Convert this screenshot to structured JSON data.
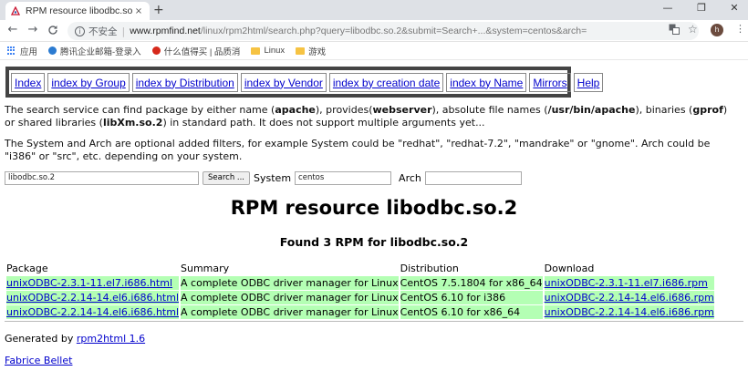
{
  "browser": {
    "tab_title": "RPM resource libodbc.so.2",
    "tab_close": "×",
    "new_tab": "+",
    "window_controls": [
      "—",
      "❐",
      "✕"
    ],
    "nav": {
      "back": "←",
      "forward": "→",
      "reload": "C"
    },
    "security_label": "不安全",
    "url_host": "www.rpmfind.net",
    "url_path": "/linux/rpm2html/search.php?query=libodbc.so.2&submit=Search+...&system=centos&arch=",
    "profile_initial": "h",
    "bookmarks": [
      {
        "label": "应用",
        "icon": "apps-icon"
      },
      {
        "label": "腾讯企业邮箱-登录入",
        "icon": "mail-favicon",
        "color": "#2b7bd1"
      },
      {
        "label": "什么值得买 | 品质消",
        "icon": "smzdm-favicon",
        "color": "#d6291b"
      },
      {
        "label": "Linux",
        "icon": "folder-icon"
      },
      {
        "label": "游戏",
        "icon": "folder-icon"
      }
    ]
  },
  "menu": [
    "Index",
    "index by Group",
    "index by Distribution",
    "index by Vendor",
    "index by creation date",
    "index by Name",
    "Mirrors",
    "Help"
  ],
  "intro": {
    "p1_a": "The search service can find package by either name (",
    "p1_b": "apache",
    "p1_c": "), provides(",
    "p1_d": "webserver",
    "p1_e": "), absolute file names (",
    "p1_f": "/usr/bin/apache",
    "p1_g": "), binaries (",
    "p1_h": "gprof",
    "p1_i": ") or shared libraries (",
    "p1_j": "libXm.so.2",
    "p1_k": ") in standard path. It does not support multiple arguments yet...",
    "p2": "The System and Arch are optional added filters, for example System could be \"redhat\", \"redhat-7.2\", \"mandrake\" or \"gnome\". Arch could be \"i386\" or \"src\", etc. depending on your system."
  },
  "search": {
    "query_value": "libodbc.so.2",
    "button_label": "Search ...",
    "system_label": "System",
    "system_value": "centos",
    "arch_label": "Arch",
    "arch_value": ""
  },
  "heading": "RPM resource libodbc.so.2",
  "subheading": "Found 3 RPM for libodbc.so.2",
  "table": {
    "headers": [
      "Package",
      "Summary",
      "Distribution",
      "Download"
    ],
    "rows": [
      {
        "package": "unixODBC-2.3.1-11.el7.i686.html",
        "summary": "A complete ODBC driver manager for Linux",
        "distribution": "CentOS 7.5.1804 for x86_64",
        "download": "unixODBC-2.3.1-11.el7.i686.rpm"
      },
      {
        "package": "unixODBC-2.2.14-14.el6.i686.html",
        "summary": "A complete ODBC driver manager for Linux",
        "distribution": "CentOS 6.10 for i386",
        "download": "unixODBC-2.2.14-14.el6.i686.rpm"
      },
      {
        "package": "unixODBC-2.2.14-14.el6.i686.html",
        "summary": "A complete ODBC driver manager for Linux",
        "distribution": "CentOS 6.10 for x86_64",
        "download": "unixODBC-2.2.14-14.el6.i686.rpm"
      }
    ]
  },
  "footer": {
    "generated_by": "Generated by ",
    "generator_link": "rpm2html 1.6",
    "author_link": "Fabrice Bellet"
  },
  "colors": {
    "row_bg": "#b4ffb4",
    "link": "#0000cc"
  }
}
